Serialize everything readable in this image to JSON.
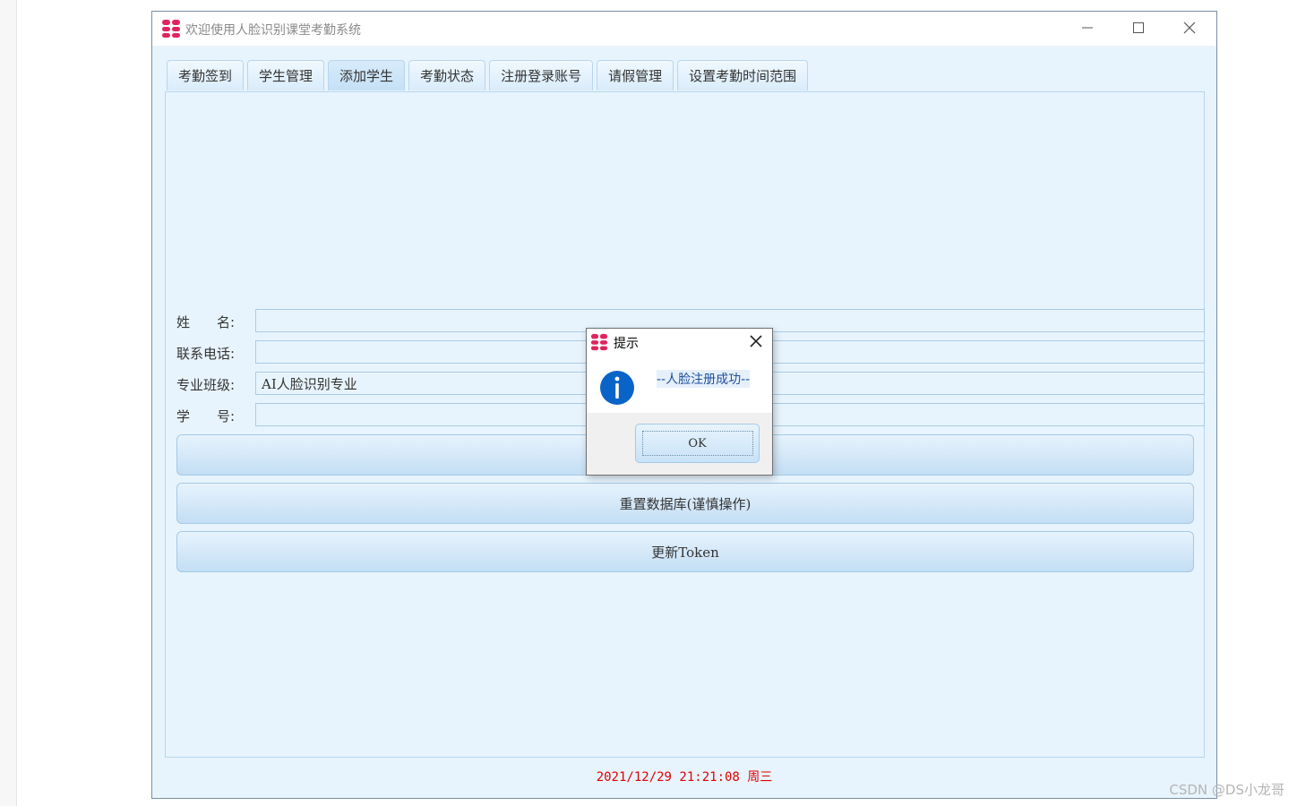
{
  "window": {
    "title": "欢迎使用人脸识别课堂考勤系统"
  },
  "tabs": [
    {
      "label": "考勤签到"
    },
    {
      "label": "学生管理"
    },
    {
      "label": "添加学生",
      "active": true
    },
    {
      "label": "考勤状态"
    },
    {
      "label": "注册登录账号"
    },
    {
      "label": "请假管理"
    },
    {
      "label": "设置考勤时间范围"
    }
  ],
  "form": {
    "name_label": "姓　　名:",
    "name_value": "",
    "phone_label": "联系电话:",
    "phone_value": "",
    "class_label": "专业班级:",
    "class_value": "AI人脸识别专业",
    "id_label": "学　　号:",
    "id_value": ""
  },
  "buttons": {
    "register_label": "",
    "reset_db_label": "重置数据库(谨慎操作)",
    "update_token_label": "更新Token"
  },
  "status": {
    "datetime": "2021/12/29 21:21:08 周三"
  },
  "dialog": {
    "title": "提示",
    "message": "--人脸注册成功--",
    "ok_label": "OK"
  },
  "watermark": "CSDN @DS小龙哥",
  "colors": {
    "window_bg": "#e8f4fd",
    "status_text": "#e00000",
    "logo_red": "#e0245e",
    "info_blue": "#0a64c8"
  }
}
